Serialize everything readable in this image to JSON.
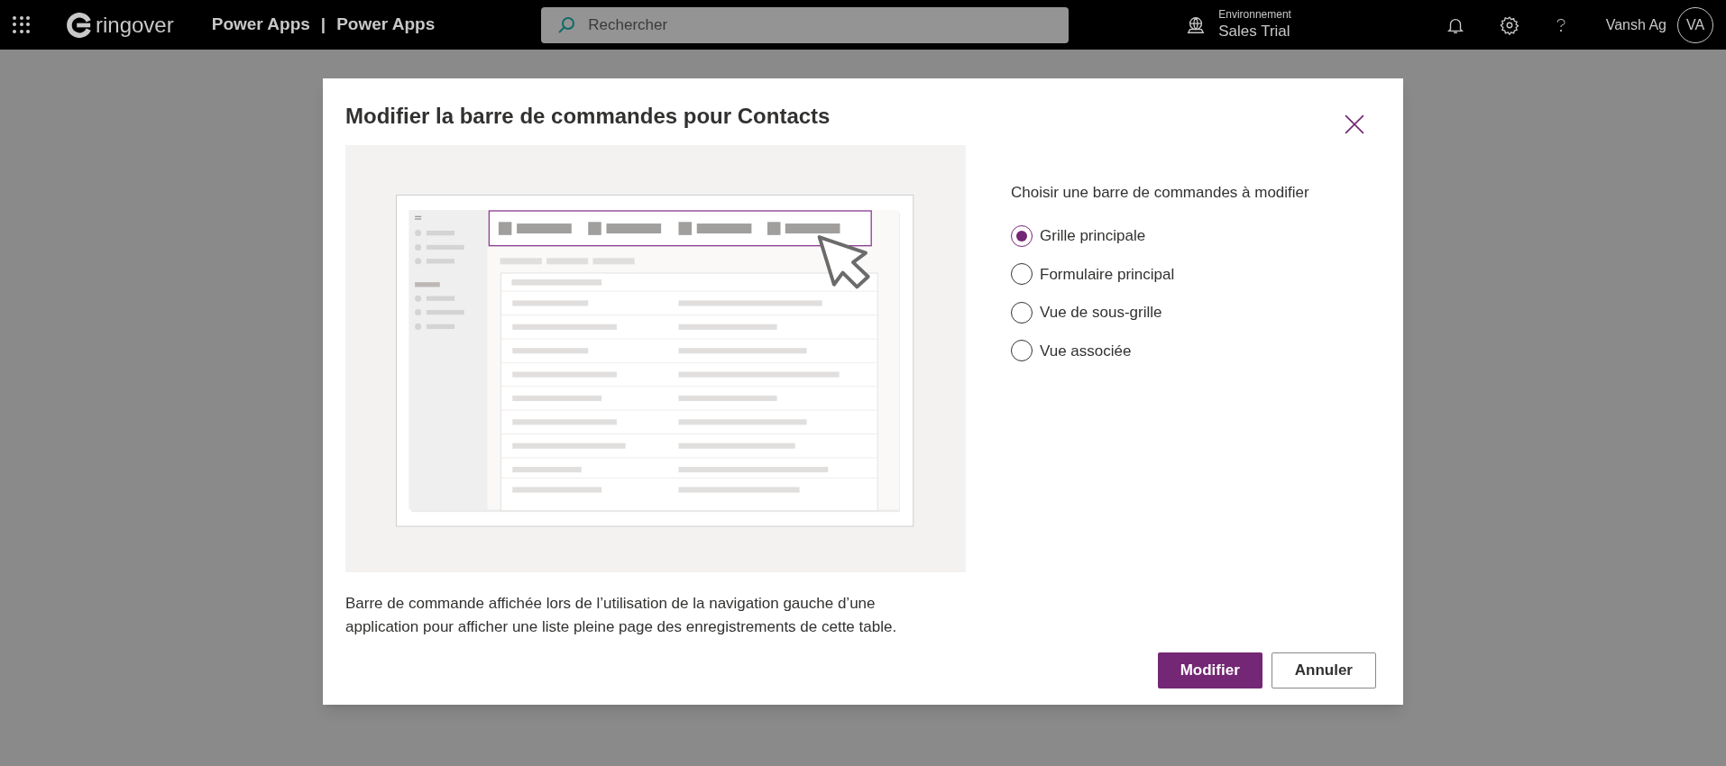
{
  "topbar": {
    "brand": "ringover",
    "app_title": "Power Apps",
    "separator": "|",
    "app_name": "Power Apps",
    "search": {
      "placeholder": "Rechercher"
    },
    "environment": {
      "label": "Environnement",
      "name": "Sales Trial"
    },
    "user_name": "Vansh Ag",
    "avatar_initials": "VA"
  },
  "dialog": {
    "title": "Modifier la barre de commandes pour Contacts",
    "description": "Barre de commande affichée lors de l’utilisation de la navigation gauche d’une application pour afficher une liste pleine page des enregistrements de cette table.",
    "options_label": "Choisir une barre de commandes à modifier",
    "options": [
      {
        "label": "Grille principale",
        "selected": true
      },
      {
        "label": "Formulaire principal",
        "selected": false
      },
      {
        "label": "Vue de sous-grille",
        "selected": false
      },
      {
        "label": "Vue associée",
        "selected": false
      }
    ],
    "buttons": [
      {
        "label": "Modifier",
        "kind": "primary"
      },
      {
        "label": "Annuler",
        "kind": "secondary"
      }
    ]
  }
}
